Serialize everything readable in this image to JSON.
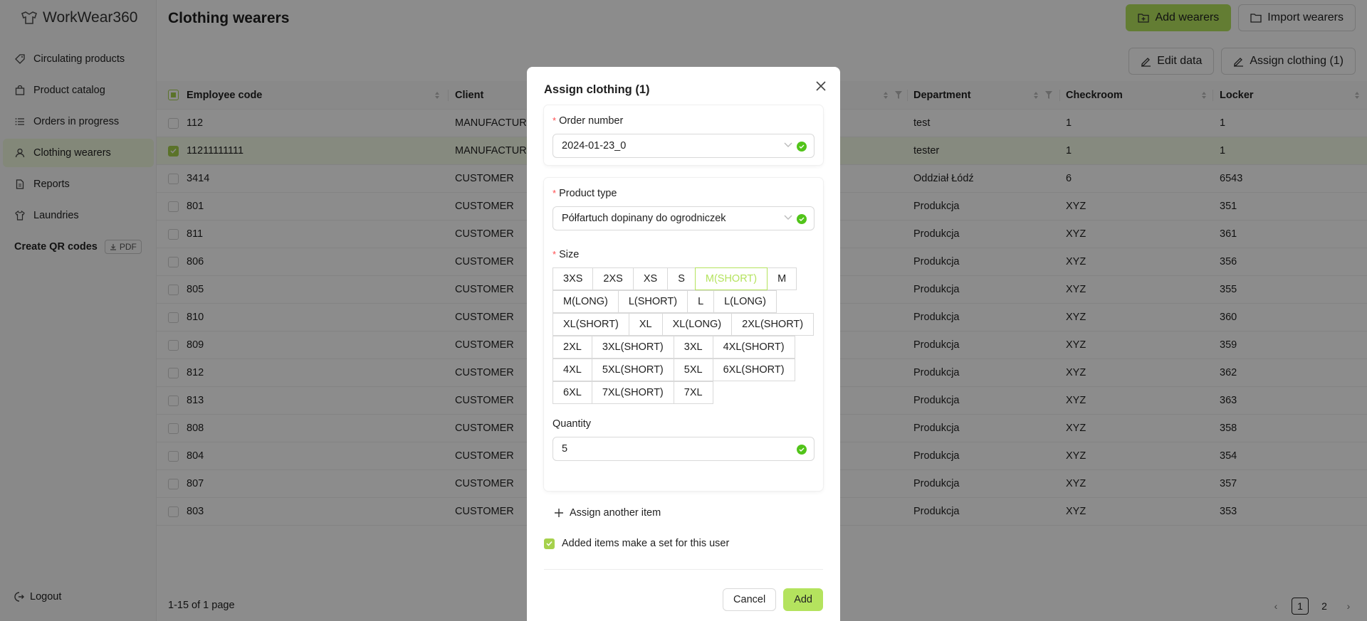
{
  "app": {
    "name": "WorkWear360"
  },
  "sidebar": {
    "items": [
      {
        "label": "Circulating products",
        "icon": "tag-icon"
      },
      {
        "label": "Product catalog",
        "icon": "bag-icon"
      },
      {
        "label": "Orders in progress",
        "icon": "list-icon"
      },
      {
        "label": "Clothing wearers",
        "icon": "user-icon",
        "active": true
      },
      {
        "label": "Reports",
        "icon": "file-icon"
      },
      {
        "label": "Laundries",
        "icon": "shirt-icon"
      }
    ],
    "qr_label": "Create QR codes",
    "pdf_label": "PDF",
    "logout_label": "Logout"
  },
  "page": {
    "title": "Clothing wearers",
    "add_wearers": "Add wearers",
    "import_wearers": "Import wearers",
    "edit_data": "Edit data",
    "assign_clothing": "Assign clothing (1)"
  },
  "table": {
    "columns": [
      "Employee code",
      "Client",
      "Department",
      "Checkroom",
      "Locker"
    ],
    "rows": [
      {
        "code": "112",
        "client": "MANUFACTURER",
        "dept": "test",
        "checkroom": "1",
        "locker": "1",
        "selected": false
      },
      {
        "code": "11211111111",
        "client": "MANUFACTURER",
        "dept": "tester",
        "checkroom": "1",
        "locker": "1",
        "selected": true
      },
      {
        "code": "3414",
        "client": "CUSTOMER",
        "dept": "Oddział Łódź",
        "checkroom": "6",
        "locker": "6543",
        "selected": false
      },
      {
        "code": "801",
        "client": "CUSTOMER",
        "dept": "Produkcja",
        "checkroom": "XYZ",
        "locker": "351",
        "selected": false
      },
      {
        "code": "811",
        "client": "CUSTOMER",
        "dept": "Produkcja",
        "checkroom": "XYZ",
        "locker": "361",
        "selected": false
      },
      {
        "code": "806",
        "client": "CUSTOMER",
        "dept": "Produkcja",
        "checkroom": "XYZ",
        "locker": "356",
        "selected": false
      },
      {
        "code": "805",
        "client": "CUSTOMER",
        "dept": "Produkcja",
        "checkroom": "XYZ",
        "locker": "355",
        "selected": false
      },
      {
        "code": "810",
        "client": "CUSTOMER",
        "dept": "Produkcja",
        "checkroom": "XYZ",
        "locker": "360",
        "selected": false
      },
      {
        "code": "809",
        "client": "CUSTOMER",
        "dept": "Produkcja",
        "checkroom": "XYZ",
        "locker": "359",
        "selected": false
      },
      {
        "code": "812",
        "client": "CUSTOMER",
        "dept": "Produkcja",
        "checkroom": "XYZ",
        "locker": "362",
        "selected": false
      },
      {
        "code": "813",
        "client": "CUSTOMER",
        "dept": "Produkcja",
        "checkroom": "XYZ",
        "locker": "363",
        "selected": false
      },
      {
        "code": "808",
        "client": "CUSTOMER",
        "dept": "Produkcja",
        "checkroom": "XYZ",
        "locker": "358",
        "selected": false
      },
      {
        "code": "804",
        "client": "CUSTOMER",
        "dept": "Produkcja",
        "checkroom": "XYZ",
        "locker": "354",
        "selected": false
      },
      {
        "code": "807",
        "client": "CUSTOMER",
        "dept": "Produkcja",
        "checkroom": "XYZ",
        "locker": "357",
        "selected": false
      },
      {
        "code": "803",
        "client": "CUSTOMER",
        "dept": "Produkcja",
        "checkroom": "XYZ",
        "locker": "353",
        "selected": false
      }
    ],
    "footer": "1-15 of 1 page",
    "pages": [
      "1",
      "2"
    ],
    "current_page": "1"
  },
  "modal": {
    "title": "Assign clothing (1)",
    "order_number_label": "Order number",
    "order_number_value": "2024-01-23_0",
    "product_type_label": "Product type",
    "product_type_value": "Półfartuch dopinany do ogrodniczek",
    "size_label": "Size",
    "size_rows": [
      [
        "3XS",
        "2XS",
        "XS",
        "S",
        "M(SHORT)",
        "M"
      ],
      [
        "M(LONG)",
        "L(SHORT)",
        "L",
        "L(LONG)"
      ],
      [
        "XL(SHORT)",
        "XL",
        "XL(LONG)",
        "2XL(SHORT)"
      ],
      [
        "2XL",
        "3XL(SHORT)",
        "3XL",
        "4XL(SHORT)"
      ],
      [
        "4XL",
        "5XL(SHORT)",
        "5XL",
        "6XL(SHORT)"
      ],
      [
        "6XL",
        "7XL(SHORT)",
        "7XL"
      ]
    ],
    "selected_size": "M(SHORT)",
    "quantity_label": "Quantity",
    "quantity_value": "5",
    "assign_another": "Assign another item",
    "set_label": "Added items make a set for this user",
    "set_checked": true,
    "cancel": "Cancel",
    "add": "Add"
  },
  "colors": {
    "accent": "#b4e35e",
    "success": "#52c41a"
  }
}
